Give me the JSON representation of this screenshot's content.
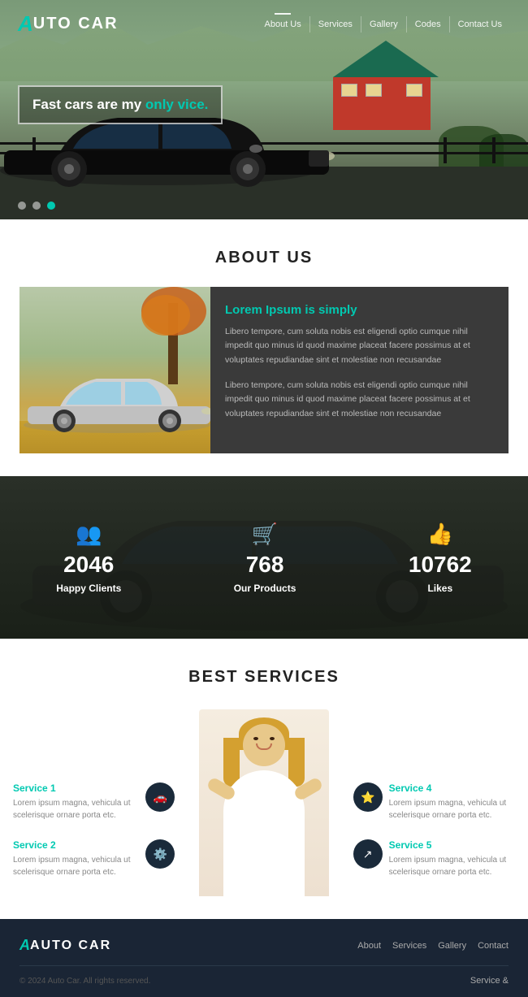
{
  "header": {
    "logo_icon": "A",
    "logo_text": "UTO CAR",
    "nav": [
      {
        "label": "About Us",
        "active": false
      },
      {
        "label": "Services",
        "active": false
      },
      {
        "label": "Gallery",
        "active": false
      },
      {
        "label": "Codes",
        "active": false
      },
      {
        "label": "Contact Us",
        "active": false
      }
    ]
  },
  "hero": {
    "headline_prefix": "Fast cars are my ",
    "headline_highlight": "only vice.",
    "dots": [
      false,
      false,
      true
    ]
  },
  "about": {
    "section_title": "ABOUT US",
    "heading": "Lorem Ipsum is simply",
    "para1": "Libero tempore, cum soluta nobis est eligendi optio cumque nihil impedit quo minus id quod maxime placeat facere possimus at et voluptates repudiandae sint et molestiae non recusandae",
    "para2": "Libero tempore, cum soluta nobis est eligendi optio cumque nihil impedit quo minus id quod maxime placeat facere possimus at et voluptates repudiandae sint et molestiae non recusandae"
  },
  "stats": {
    "items": [
      {
        "icon": "👥",
        "number": "2046",
        "label": "Happy Clients"
      },
      {
        "icon": "🛒",
        "number": "768",
        "label": "Our Products"
      },
      {
        "icon": "👍",
        "number": "10762",
        "label": "Likes"
      }
    ]
  },
  "services": {
    "section_title": "BEST SERVICES",
    "left": [
      {
        "title": "Service 1",
        "desc": "Lorem ipsum magna, vehicula ut scelerisque ornare porta etc.",
        "icon": "🚗"
      },
      {
        "title": "Service 2",
        "desc": "Lorem ipsum magna, vehicula ut scelerisque ornare porta etc.",
        "icon": "⚙️"
      }
    ],
    "right": [
      {
        "title": "Service 4",
        "desc": "Lorem ipsum magna, vehicula ut scelerisque ornare porta etc.",
        "icon": "⭐"
      },
      {
        "title": "Service 5",
        "desc": "Lorem ipsum magna, vehicula ut scelerisque ornare porta etc.",
        "icon": "↗️"
      }
    ]
  },
  "footer": {
    "logo": "AUTO CAR",
    "links": [
      "About",
      "Services",
      "Gallery",
      "Contact"
    ],
    "copyright": "© 2024 Auto Car. All rights reserved.",
    "service_text": "Service &"
  }
}
